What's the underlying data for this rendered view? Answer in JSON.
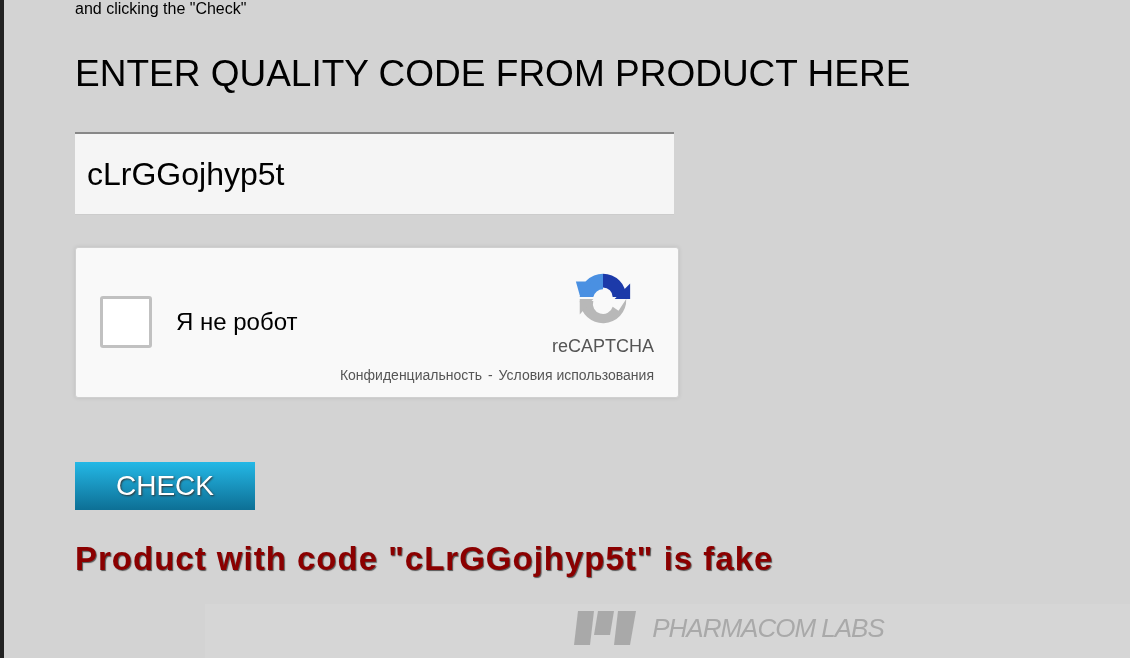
{
  "intro_text": "and clicking the \"Check\"",
  "heading": "ENTER QUALITY CODE FROM PRODUCT HERE",
  "code_field": {
    "value": "cLrGGojhyp5t"
  },
  "captcha": {
    "label": "Я не робот",
    "checked": false,
    "brand": "reCAPTCHA",
    "privacy_link": "Конфиденциальность",
    "separator": "-",
    "terms_link": "Условия использования"
  },
  "check_button": "CHECK",
  "result": {
    "message": "Product with code \"cLrGGojhyp5t\" is fake"
  },
  "footer_logo": "PHARMACOM LABS"
}
